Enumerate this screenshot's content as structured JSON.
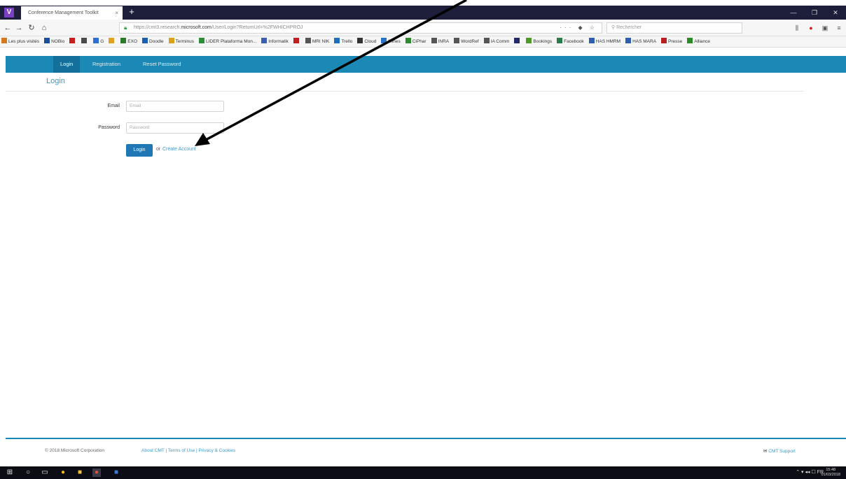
{
  "browser": {
    "tab_title": "Conference Management Toolkit",
    "tab_close": "×",
    "new_tab": "+",
    "url_prefix": "https://cmt3.research.",
    "url_domain": "microsoft.com",
    "url_suffix": "/User/Login?ReturnUrl=%2FWHICHPROJ",
    "search_placeholder": "Rechercher",
    "address_actions": "··· ◆ ☆"
  },
  "bookmarks": [
    {
      "label": "Les plus visités",
      "color": "#d47a1e"
    },
    {
      "label": "NOBio",
      "color": "#1b4f9a"
    },
    {
      "label": "",
      "color": "#c81e1e"
    },
    {
      "label": "",
      "color": "#4a4a4a"
    },
    {
      "label": "G",
      "color": "#2d6fd6"
    },
    {
      "label": "",
      "color": "#e0a020"
    },
    {
      "label": "EXO",
      "color": "#2b7a2b"
    },
    {
      "label": "Doodle",
      "color": "#1c5fb0"
    },
    {
      "label": "Terminus",
      "color": "#d8a21a"
    },
    {
      "label": "LIDER Plataforma Mon...",
      "color": "#2e8b3a"
    },
    {
      "label": "Informatik",
      "color": "#3a5fb0"
    },
    {
      "label": "",
      "color": "#c02020"
    },
    {
      "label": "MRI NIK",
      "color": "#555555"
    },
    {
      "label": "Trello",
      "color": "#1e6fb8"
    },
    {
      "label": "Cloud",
      "color": "#333333"
    },
    {
      "label": "Mines",
      "color": "#2a72c4"
    },
    {
      "label": "CiPhar",
      "color": "#2f8a2f"
    },
    {
      "label": "INRA",
      "color": "#555555"
    },
    {
      "label": "WordRef",
      "color": "#555555"
    },
    {
      "label": "IA Comm",
      "color": "#555555"
    },
    {
      "label": "",
      "color": "#222a6b"
    },
    {
      "label": "Bookings",
      "color": "#4a9a2a"
    },
    {
      "label": "Facebook",
      "color": "#2a7a4a"
    },
    {
      "label": "HAS HMRM",
      "color": "#2a5fb0"
    },
    {
      "label": "HAS MARA",
      "color": "#2a5fb0"
    },
    {
      "label": "Presse",
      "color": "#b82020"
    },
    {
      "label": "Alliance",
      "color": "#2a8a2a"
    }
  ],
  "site": {
    "tabs": [
      "Login",
      "Registration",
      "Reset Password"
    ],
    "page_title": "Login",
    "email_label": "Email",
    "email_placeholder": "Email",
    "password_label": "Password",
    "password_placeholder": "Password",
    "login_button": "Login",
    "or_text": "or",
    "create_account": "Create Account"
  },
  "footer": {
    "copyright": "© 2018 Microsoft Corporation",
    "links": "About CMT | Terms of Use | Privacy & Cookies",
    "support": "CMT Support"
  },
  "taskbar": {
    "time": "15:48",
    "date": "01/03/2018",
    "tray": "⌃ ▾ ◂◂ ☐ FR"
  }
}
